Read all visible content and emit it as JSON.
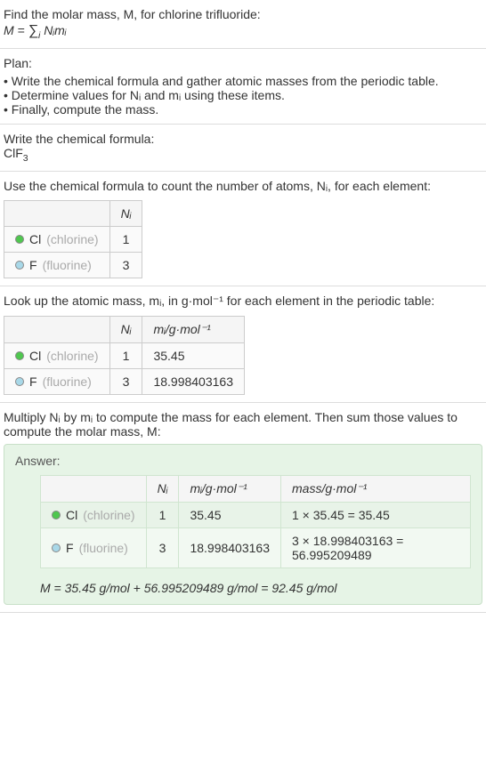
{
  "chart_data": {
    "type": "table",
    "title": "Molar mass calculation for chlorine trifluoride (ClF3)",
    "series": [
      {
        "name": "Cl (chlorine)",
        "N_i": 1,
        "m_i": 35.45,
        "mass": 35.45
      },
      {
        "name": "F (fluorine)",
        "N_i": 3,
        "m_i": 18.998403163,
        "mass": 56.995209489
      }
    ],
    "result": 92.45,
    "unit": "g/mol"
  },
  "intro": {
    "prompt": "Find the molar mass, M, for chlorine trifluoride:",
    "formula_lhs": "M = ",
    "formula_sum": "∑",
    "formula_sub": "i",
    "formula_rhs": " Nᵢmᵢ"
  },
  "plan": {
    "heading": "Plan:",
    "items": [
      "Write the chemical formula and gather atomic masses from the periodic table.",
      "Determine values for Nᵢ and mᵢ using these items.",
      "Finally, compute the mass."
    ]
  },
  "formula_section": {
    "heading": "Write the chemical formula:",
    "formula_base": "ClF",
    "formula_sub": "3"
  },
  "count_section": {
    "heading": "Use the chemical formula to count the number of atoms, Nᵢ, for each element:",
    "header_ni": "Nᵢ",
    "rows": [
      {
        "dot": "dot-cl",
        "symbol": "Cl",
        "name": "(chlorine)",
        "ni": "1"
      },
      {
        "dot": "dot-f",
        "symbol": "F",
        "name": "(fluorine)",
        "ni": "3"
      }
    ]
  },
  "mass_section": {
    "heading": "Look up the atomic mass, mᵢ, in g·mol⁻¹ for each element in the periodic table:",
    "header_ni": "Nᵢ",
    "header_mi": "mᵢ/g·mol⁻¹",
    "rows": [
      {
        "dot": "dot-cl",
        "symbol": "Cl",
        "name": "(chlorine)",
        "ni": "1",
        "mi": "35.45"
      },
      {
        "dot": "dot-f",
        "symbol": "F",
        "name": "(fluorine)",
        "ni": "3",
        "mi": "18.998403163"
      }
    ]
  },
  "multiply_section": {
    "heading": "Multiply Nᵢ by mᵢ to compute the mass for each element. Then sum those values to compute the molar mass, M:"
  },
  "answer": {
    "label": "Answer:",
    "header_ni": "Nᵢ",
    "header_mi": "mᵢ/g·mol⁻¹",
    "header_mass": "mass/g·mol⁻¹",
    "rows": [
      {
        "dot": "dot-cl",
        "symbol": "Cl",
        "name": "(chlorine)",
        "ni": "1",
        "mi": "35.45",
        "mass": "1 × 35.45 = 35.45"
      },
      {
        "dot": "dot-f",
        "symbol": "F",
        "name": "(fluorine)",
        "ni": "3",
        "mi": "18.998403163",
        "mass": "3 × 18.998403163 = 56.995209489"
      }
    ],
    "final": "M = 35.45 g/mol + 56.995209489 g/mol = 92.45 g/mol"
  }
}
